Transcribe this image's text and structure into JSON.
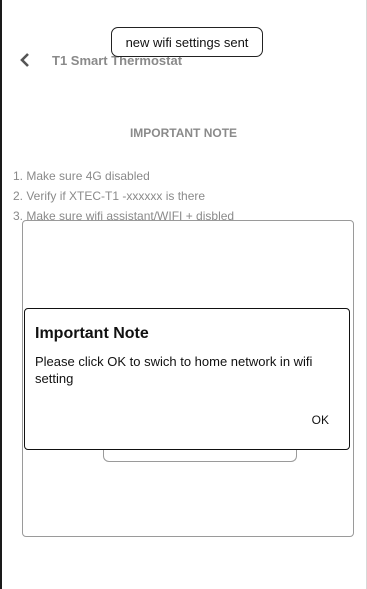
{
  "header": {
    "title": "T1 Smart Thermostat",
    "back_icon": "chevron-left-icon"
  },
  "toast": {
    "text": "new wifi settings sent"
  },
  "instructions": {
    "title": "IMPORTANT NOTE",
    "steps": [
      "1. Make sure 4G disabled",
      "2. Verify if XTEC-T1 -xxxxxx is there",
      "3. Make sure wifi assistant/WIFI + disbled"
    ]
  },
  "dialog": {
    "title": "Important Note",
    "message": "Please click OK to swich to home network in wifi setting",
    "ok_label": "OK"
  }
}
